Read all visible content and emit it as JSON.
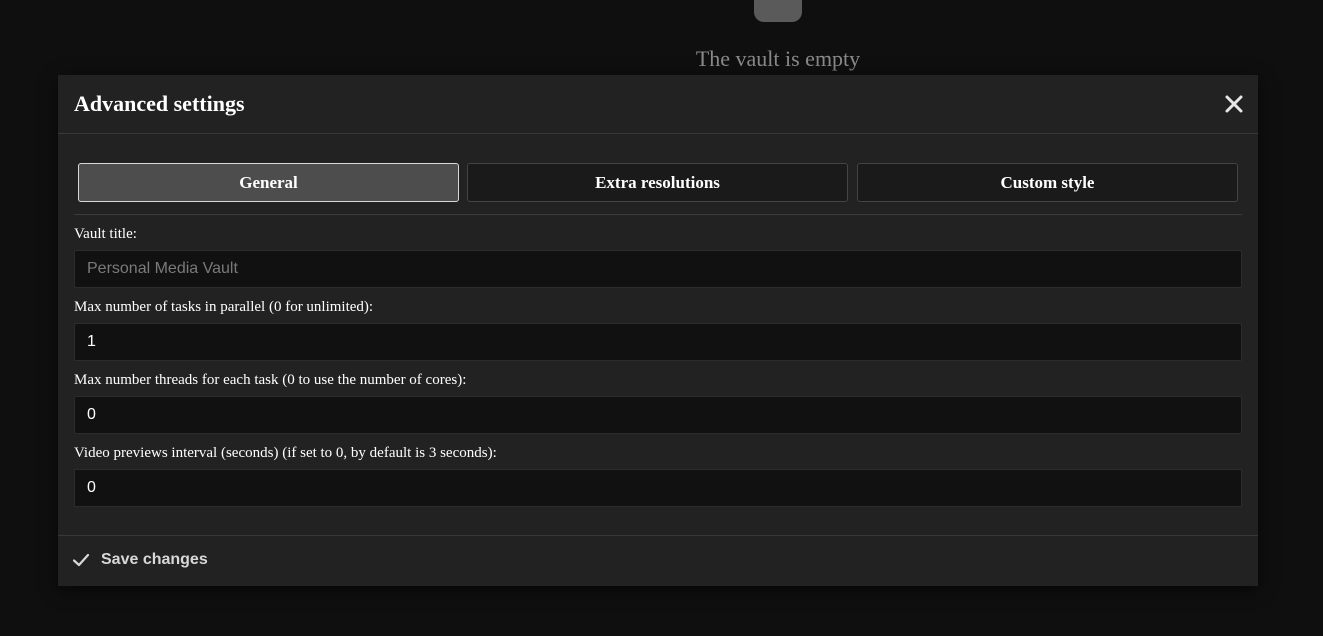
{
  "background": {
    "empty_message": "The vault is empty",
    "icon": "vault-icon"
  },
  "modal": {
    "title": "Advanced settings",
    "close_icon": "close-icon",
    "tabs": [
      {
        "label": "General",
        "active": true
      },
      {
        "label": "Extra resolutions",
        "active": false
      },
      {
        "label": "Custom style",
        "active": false
      }
    ],
    "fields": [
      {
        "label": "Vault title:",
        "value": "",
        "placeholder": "Personal Media Vault"
      },
      {
        "label": "Max number of tasks in parallel (0 for unlimited):",
        "value": "1",
        "placeholder": ""
      },
      {
        "label": "Max number threads for each task (0 to use the number of cores):",
        "value": "0",
        "placeholder": ""
      },
      {
        "label": "Video previews interval (seconds) (if set to 0, by default is 3 seconds):",
        "value": "0",
        "placeholder": ""
      }
    ],
    "footer": {
      "save_label": "Save changes",
      "save_icon": "check-icon"
    }
  },
  "colors": {
    "page_background": "#0f0f0f",
    "modal_background": "#222222",
    "input_background": "#111111",
    "active_tab": "#4d4d4d"
  }
}
